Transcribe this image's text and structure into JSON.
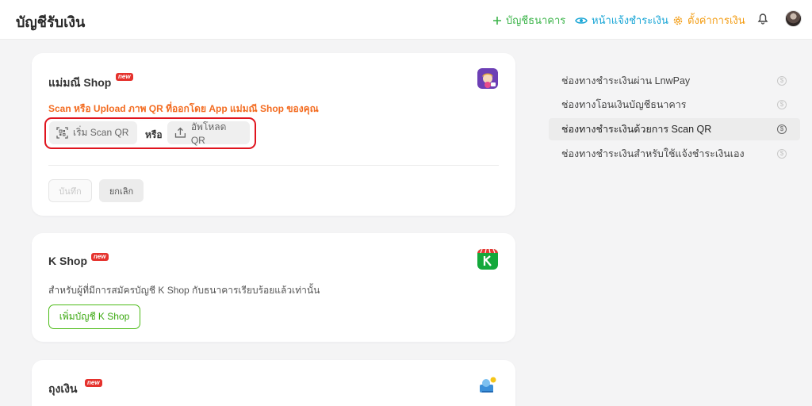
{
  "header": {
    "title": "บัญชีรับเงิน",
    "links": {
      "bank": "บัญชีธนาคาร",
      "notify": "หน้าแจ้งชำระเงิน",
      "settings": "ตั้งค่าการเงิน"
    }
  },
  "badge_new": "new",
  "cards": {
    "mamanee": {
      "title": "แม่มณี Shop",
      "instruction": "Scan หรือ Upload ภาพ QR ที่ออกโดย App แม่มณี Shop ของคุณ",
      "scan_label": "เริ่ม Scan QR",
      "or_label": "หรือ",
      "upload_label": "อัพโหลด QR",
      "save_label": "บันทึก",
      "cancel_label": "ยกเลิก"
    },
    "kshop": {
      "title": "K Shop",
      "description": "สำหรับผู้ที่มีการสมัครบัญชี K Shop กับธนาคารเรียบร้อยแล้วเท่านั้น",
      "add_label": "เพิ่มบัญชี K Shop"
    },
    "tungngern": {
      "title": "ถุงเงิน"
    }
  },
  "sidebar": {
    "items": [
      {
        "label": "ช่องทางชำระเงินผ่าน LnwPay",
        "active": false
      },
      {
        "label": "ช่องทางโอนเงินบัญชีธนาคาร",
        "active": false
      },
      {
        "label": "ช่องทางชำระเงินด้วยการ Scan QR",
        "active": true
      },
      {
        "label": "ช่องทางชำระเงินสำหรับใช้แจ้งชำระเงินเอง",
        "active": false
      }
    ],
    "coin_symbol": "$"
  },
  "colors": {
    "green": "#3cb44a",
    "blue": "#1aa6d6",
    "orange": "#f39c12",
    "instruction_orange": "#f36c21",
    "highlight_red": "#e0141e"
  }
}
